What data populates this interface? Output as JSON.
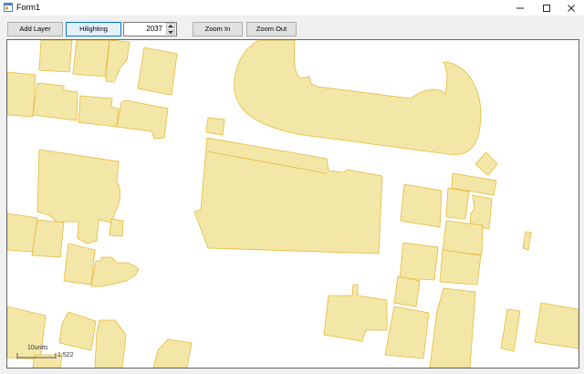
{
  "window": {
    "title": "Form1",
    "icon": "app-form-icon",
    "controls": [
      "minimize-icon",
      "maximize-icon",
      "close-icon"
    ]
  },
  "toolbar": {
    "add_layer_label": "Add Layer",
    "hilighting_label": "Hilighting",
    "spinner_value": "2037",
    "zoom_in_label": "Zoom In",
    "zoom_out_label": "Zoom Out"
  },
  "map": {
    "fill_color": "#f3e7a8",
    "stroke_color": "#e8b838",
    "scale_label": "10units",
    "scale_ratio": "1:522"
  }
}
